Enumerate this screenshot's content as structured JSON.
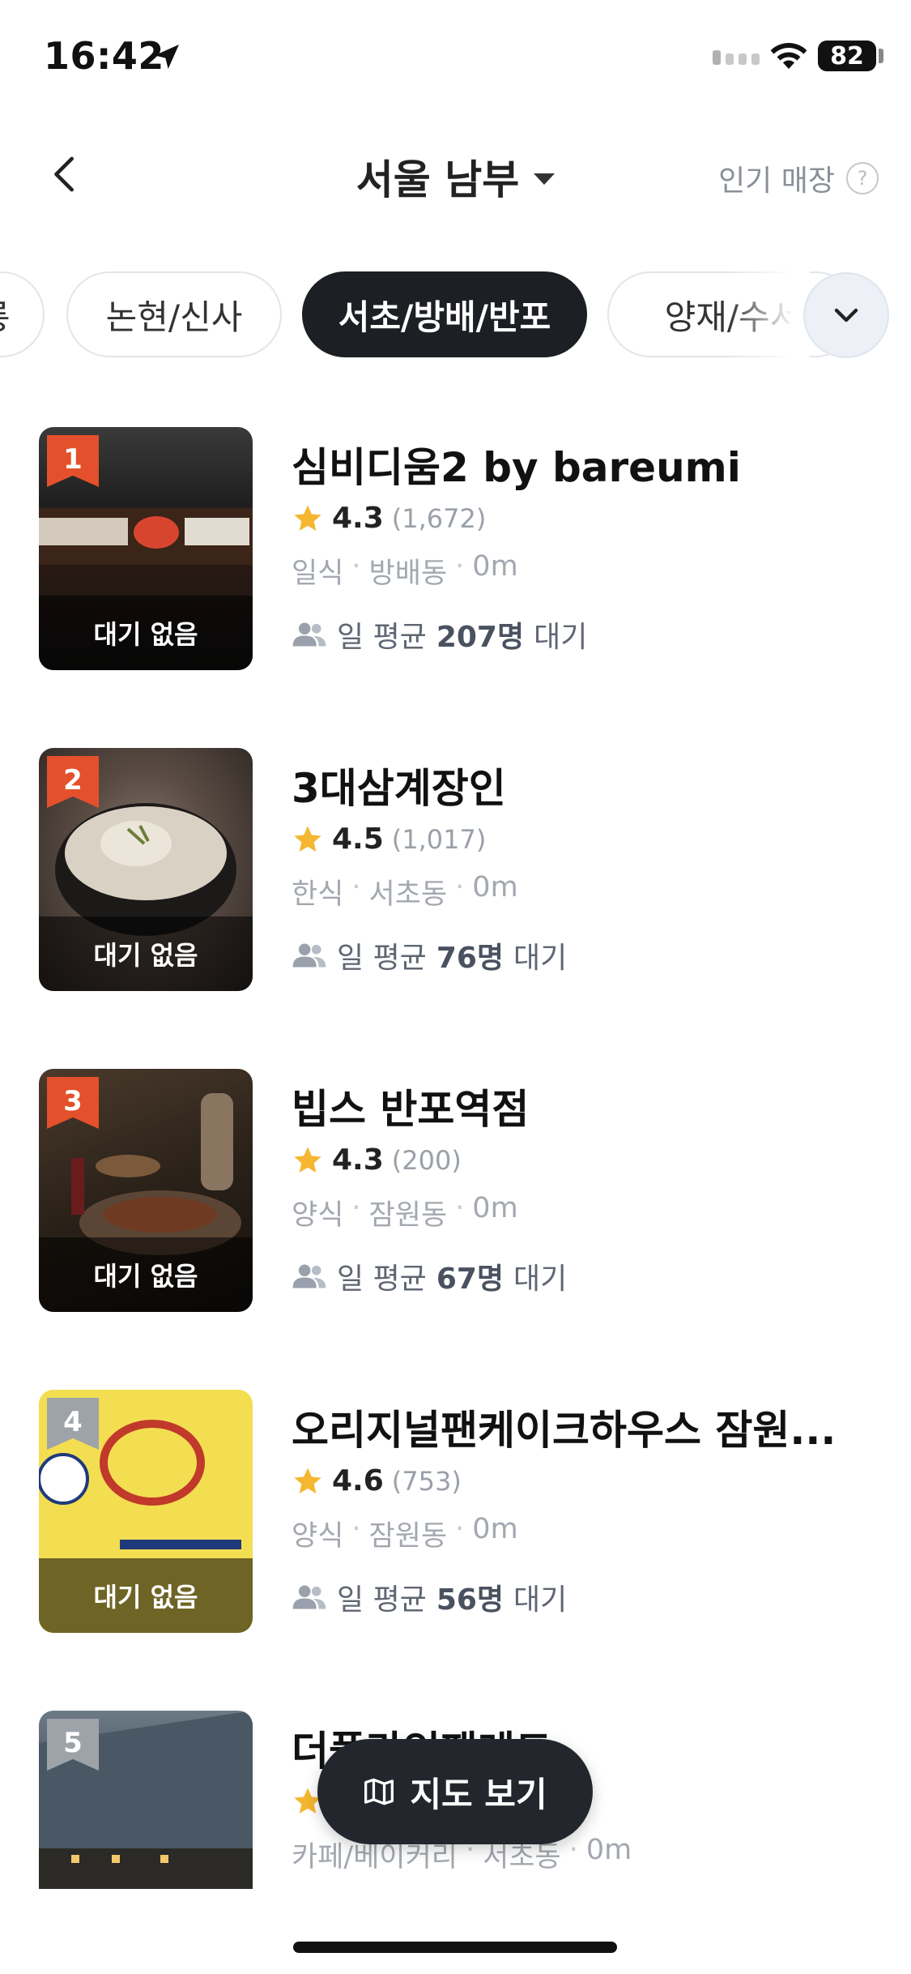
{
  "status_bar": {
    "time": "16:42",
    "battery": "82"
  },
  "header": {
    "title": "서울 남부",
    "popular_label": "인기 매장",
    "help": "?"
  },
  "chips": [
    {
      "label": "강남/역삼/선릉",
      "active": false
    },
    {
      "label": "논현/신사",
      "active": false
    },
    {
      "label": "서초/방배/반포",
      "active": true
    },
    {
      "label": "양재/수서",
      "active": false
    }
  ],
  "restaurants": [
    {
      "rank": "1",
      "rank_color": "#e4502b",
      "name": "심비디움2 by bareumi",
      "rating": "4.3",
      "reviews": "(1,672)",
      "category": "일식",
      "area": "방배동",
      "distance": "0m",
      "wait_prefix": "일 평균",
      "wait_count": "207명",
      "wait_suffix": "대기",
      "status": "대기 없음"
    },
    {
      "rank": "2",
      "rank_color": "#e4502b",
      "name": "3대삼계장인",
      "rating": "4.5",
      "reviews": "(1,017)",
      "category": "한식",
      "area": "서초동",
      "distance": "0m",
      "wait_prefix": "일 평균",
      "wait_count": "76명",
      "wait_suffix": "대기",
      "status": "대기 없음"
    },
    {
      "rank": "3",
      "rank_color": "#e4502b",
      "name": "빕스 반포역점",
      "rating": "4.3",
      "reviews": "(200)",
      "category": "양식",
      "area": "잠원동",
      "distance": "0m",
      "wait_prefix": "일 평균",
      "wait_count": "67명",
      "wait_suffix": "대기",
      "status": "대기 없음"
    },
    {
      "rank": "4",
      "rank_color": "#9ea3aa",
      "name": "오리지널팬케이크하우스 잠원...",
      "rating": "4.6",
      "reviews": "(753)",
      "category": "양식",
      "area": "잠원동",
      "distance": "0m",
      "wait_prefix": "일 평균",
      "wait_count": "56명",
      "wait_suffix": "대기",
      "status": "대기 없음"
    },
    {
      "rank": "5",
      "rank_color": "#9ea3aa",
      "name": "더플라잉팬레드",
      "rating": "",
      "reviews": "",
      "category": "카페/베이커리",
      "area": "서초동",
      "distance": "0m",
      "wait_prefix": "",
      "wait_count": "",
      "wait_suffix": "",
      "status": ""
    }
  ],
  "map_button": {
    "label": "지도 보기"
  }
}
